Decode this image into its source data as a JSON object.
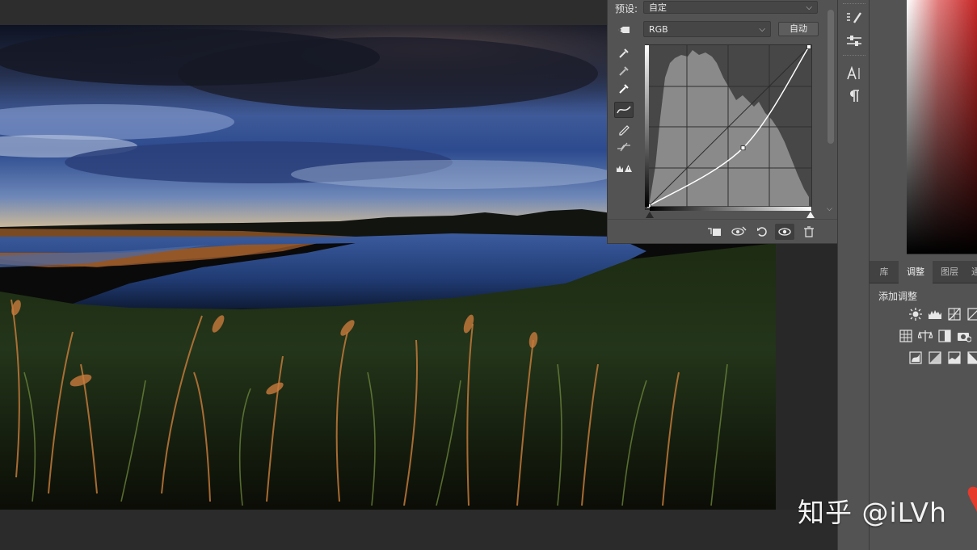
{
  "properties_panel": {
    "preset_label": "预设:",
    "preset_value": "自定",
    "channel_value": "RGB",
    "auto_button": "自动",
    "tools": [
      "hand-target-icon",
      "eyedropper-black-icon",
      "eyedropper-gray-icon",
      "eyedropper-white-icon",
      "curve-point-icon",
      "pencil-icon",
      "smooth-icon",
      "clipping-warning-icon"
    ],
    "curve": {
      "points": [
        [
          0,
          0
        ],
        [
          150,
          93
        ],
        [
          255,
          255
        ]
      ],
      "range": [
        0,
        255
      ]
    },
    "footer_buttons": [
      "clip-to-layer-icon",
      "view-previous-icon",
      "reset-icon",
      "visibility-icon",
      "delete-icon"
    ]
  },
  "right_panel": {
    "tabs": [
      "库",
      "调整",
      "图层",
      "通"
    ],
    "active_tab": "调整",
    "add_adjustment_label": "添加调整",
    "color_accent": "#c62828"
  },
  "toolstrip": [
    "brush-settings-icon",
    "adjustments-sliders-icon",
    "character-icon",
    "paragraph-icon"
  ],
  "watermark": {
    "text": "知乎 @iLVh"
  }
}
